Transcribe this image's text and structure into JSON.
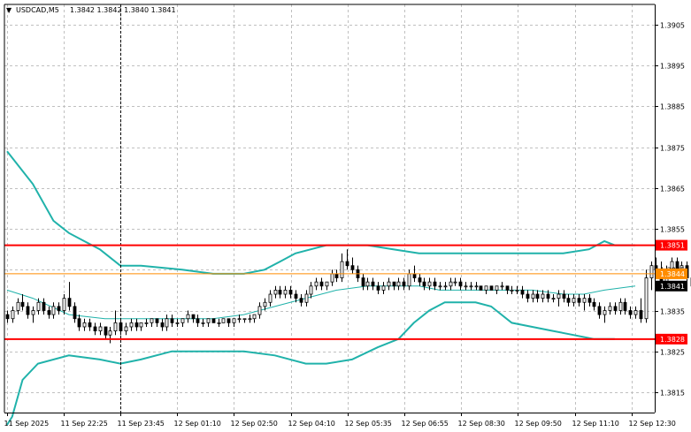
{
  "window": {
    "menu_glyph": "▼",
    "symbol_timeframe": "USDCAD,M5",
    "ohlc": "1.3842 1.3842 1.3840 1.3841"
  },
  "colors": {
    "bull": "#ffffff",
    "bear": "#000000",
    "candle_outline": "#000000",
    "band": "#20b2aa",
    "support_resistance": "#ff0000",
    "bid_line": "#ff8c00",
    "grid": "#c0c0c0",
    "axis": "#000000"
  },
  "chart_data": {
    "type": "candlestick",
    "symbol": "USDCAD",
    "timeframe": "M5",
    "ylim": [
      1.381,
      1.391
    ],
    "grid": true,
    "x_tick_labels": [
      "11 Sep 2025",
      "11 Sep 22:25",
      "11 Sep 23:45",
      "12 Sep 01:10",
      "12 Sep 02:50",
      "12 Sep 04:10",
      "12 Sep 05:35",
      "12 Sep 06:55",
      "12 Sep 08:30",
      "12 Sep 09:50",
      "12 Sep 11:10",
      "12 Sep 12:30"
    ],
    "y_ticks": [
      {
        "value": 1.3905,
        "label": "1.3905"
      },
      {
        "value": 1.3895,
        "label": "1.3895"
      },
      {
        "value": 1.3885,
        "label": "1.3885"
      },
      {
        "value": 1.3875,
        "label": "1.3875"
      },
      {
        "value": 1.3865,
        "label": "1.3865"
      },
      {
        "value": 1.3855,
        "label": "1.3855"
      },
      {
        "value": 1.3845,
        "label": "1.3845"
      },
      {
        "value": 1.3835,
        "label": "1.3835"
      },
      {
        "value": 1.3825,
        "label": "1.3825"
      },
      {
        "value": 1.3815,
        "label": "1.3815"
      }
    ],
    "horizontal_lines": [
      {
        "name": "resistance",
        "value": 1.3851,
        "label": "1.3851"
      },
      {
        "name": "support",
        "value": 1.3828,
        "label": "1.3828"
      }
    ],
    "bid_line": {
      "value": 1.3844,
      "label": "1.3844"
    },
    "current_price": {
      "value": 1.3841,
      "label": "1.3841"
    },
    "vertical_marker_index": 22,
    "candles": [
      [
        1.3834,
        1.3835,
        1.3832,
        1.3833
      ],
      [
        1.3833,
        1.3836,
        1.3832,
        1.3835
      ],
      [
        1.3835,
        1.3838,
        1.3834,
        1.3837
      ],
      [
        1.3837,
        1.3839,
        1.3835,
        1.3836
      ],
      [
        1.3836,
        1.3837,
        1.3833,
        1.3834
      ],
      [
        1.3834,
        1.3836,
        1.3832,
        1.3835
      ],
      [
        1.3835,
        1.3838,
        1.3834,
        1.3837
      ],
      [
        1.3837,
        1.3838,
        1.3834,
        1.3835
      ],
      [
        1.3835,
        1.3836,
        1.3833,
        1.3834
      ],
      [
        1.3834,
        1.3837,
        1.3833,
        1.3836
      ],
      [
        1.3836,
        1.3837,
        1.3834,
        1.3835
      ],
      [
        1.3835,
        1.3839,
        1.3834,
        1.3838
      ],
      [
        1.3838,
        1.3842,
        1.3835,
        1.3836
      ],
      [
        1.3836,
        1.3837,
        1.3832,
        1.3833
      ],
      [
        1.3833,
        1.3834,
        1.383,
        1.3831
      ],
      [
        1.3831,
        1.3833,
        1.383,
        1.3832
      ],
      [
        1.3832,
        1.3833,
        1.383,
        1.3831
      ],
      [
        1.3831,
        1.3832,
        1.3829,
        1.383
      ],
      [
        1.383,
        1.3832,
        1.3829,
        1.3831
      ],
      [
        1.3831,
        1.3831,
        1.3828,
        1.3829
      ],
      [
        1.3829,
        1.3831,
        1.3827,
        1.383
      ],
      [
        1.383,
        1.3835,
        1.3829,
        1.3832
      ],
      [
        1.3832,
        1.3833,
        1.3829,
        1.383
      ],
      [
        1.383,
        1.3832,
        1.3829,
        1.3831
      ],
      [
        1.3831,
        1.3833,
        1.383,
        1.3832
      ],
      [
        1.3832,
        1.3833,
        1.383,
        1.3831
      ],
      [
        1.3831,
        1.3832,
        1.383,
        1.3832
      ],
      [
        1.3832,
        1.3833,
        1.3831,
        1.3832
      ],
      [
        1.3832,
        1.3833,
        1.3831,
        1.3833
      ],
      [
        1.3833,
        1.3833,
        1.3831,
        1.3832
      ],
      [
        1.3832,
        1.3833,
        1.383,
        1.3831
      ],
      [
        1.3831,
        1.3834,
        1.383,
        1.3833
      ],
      [
        1.3833,
        1.3834,
        1.3831,
        1.3832
      ],
      [
        1.3832,
        1.3833,
        1.3831,
        1.3832
      ],
      [
        1.3832,
        1.3833,
        1.3831,
        1.3833
      ],
      [
        1.3833,
        1.3835,
        1.3832,
        1.3834
      ],
      [
        1.3834,
        1.3834,
        1.3832,
        1.3833
      ],
      [
        1.3833,
        1.3834,
        1.3831,
        1.3832
      ],
      [
        1.3832,
        1.3833,
        1.3831,
        1.3832
      ],
      [
        1.3832,
        1.3833,
        1.3831,
        1.3833
      ],
      [
        1.3833,
        1.3833,
        1.3832,
        1.3832
      ],
      [
        1.3832,
        1.3833,
        1.3831,
        1.3832
      ],
      [
        1.3832,
        1.3833,
        1.3832,
        1.3833
      ],
      [
        1.3833,
        1.3833,
        1.3831,
        1.3832
      ],
      [
        1.3832,
        1.3833,
        1.3831,
        1.3833
      ],
      [
        1.3833,
        1.3834,
        1.3832,
        1.3833
      ],
      [
        1.3833,
        1.3833,
        1.3832,
        1.3833
      ],
      [
        1.3833,
        1.3834,
        1.3832,
        1.3833
      ],
      [
        1.3833,
        1.3834,
        1.3832,
        1.3834
      ],
      [
        1.3834,
        1.3837,
        1.3833,
        1.3836
      ],
      [
        1.3836,
        1.3838,
        1.3835,
        1.3837
      ],
      [
        1.3837,
        1.384,
        1.3836,
        1.3839
      ],
      [
        1.3839,
        1.3841,
        1.3838,
        1.384
      ],
      [
        1.384,
        1.3841,
        1.3838,
        1.3839
      ],
      [
        1.3839,
        1.3841,
        1.3838,
        1.384
      ],
      [
        1.384,
        1.3841,
        1.3838,
        1.3839
      ],
      [
        1.3839,
        1.384,
        1.3837,
        1.3838
      ],
      [
        1.3838,
        1.3839,
        1.3836,
        1.3837
      ],
      [
        1.3837,
        1.384,
        1.3836,
        1.3839
      ],
      [
        1.3839,
        1.3842,
        1.3838,
        1.3841
      ],
      [
        1.3841,
        1.3843,
        1.384,
        1.3842
      ],
      [
        1.3842,
        1.3843,
        1.384,
        1.3841
      ],
      [
        1.3841,
        1.3842,
        1.384,
        1.3842
      ],
      [
        1.3842,
        1.3845,
        1.3841,
        1.3844
      ],
      [
        1.3844,
        1.3845,
        1.3842,
        1.3843
      ],
      [
        1.3843,
        1.3849,
        1.3842,
        1.3847
      ],
      [
        1.3847,
        1.385,
        1.3845,
        1.3846
      ],
      [
        1.3846,
        1.3848,
        1.3844,
        1.3845
      ],
      [
        1.3845,
        1.3846,
        1.3842,
        1.3843
      ],
      [
        1.3843,
        1.3844,
        1.384,
        1.3841
      ],
      [
        1.3841,
        1.3843,
        1.384,
        1.3842
      ],
      [
        1.3842,
        1.3843,
        1.384,
        1.3841
      ],
      [
        1.3841,
        1.3842,
        1.3839,
        1.384
      ],
      [
        1.384,
        1.3842,
        1.3839,
        1.3841
      ],
      [
        1.3841,
        1.3843,
        1.384,
        1.3842
      ],
      [
        1.3842,
        1.3842,
        1.384,
        1.3841
      ],
      [
        1.3841,
        1.3843,
        1.384,
        1.3842
      ],
      [
        1.3842,
        1.3843,
        1.384,
        1.3841
      ],
      [
        1.3841,
        1.3845,
        1.384,
        1.3844
      ],
      [
        1.3844,
        1.3846,
        1.3842,
        1.3843
      ],
      [
        1.3843,
        1.3844,
        1.3841,
        1.3842
      ],
      [
        1.3842,
        1.3843,
        1.384,
        1.3841
      ],
      [
        1.3841,
        1.3843,
        1.384,
        1.3842
      ],
      [
        1.3842,
        1.3843,
        1.384,
        1.3841
      ],
      [
        1.3841,
        1.3842,
        1.384,
        1.3841
      ],
      [
        1.3841,
        1.3842,
        1.384,
        1.3841
      ],
      [
        1.3841,
        1.3843,
        1.384,
        1.3842
      ],
      [
        1.3842,
        1.3843,
        1.3841,
        1.3842
      ],
      [
        1.3842,
        1.3843,
        1.384,
        1.3841
      ],
      [
        1.3841,
        1.3842,
        1.384,
        1.3841
      ],
      [
        1.3841,
        1.3842,
        1.384,
        1.3841
      ],
      [
        1.3841,
        1.3842,
        1.384,
        1.3841
      ],
      [
        1.3841,
        1.3841,
        1.384,
        1.384
      ],
      [
        1.384,
        1.3841,
        1.3839,
        1.3841
      ],
      [
        1.3841,
        1.3841,
        1.384,
        1.384
      ],
      [
        1.384,
        1.3841,
        1.3839,
        1.3841
      ],
      [
        1.3841,
        1.3842,
        1.384,
        1.3841
      ],
      [
        1.3841,
        1.3841,
        1.3839,
        1.384
      ],
      [
        1.384,
        1.3841,
        1.3839,
        1.384
      ],
      [
        1.384,
        1.3841,
        1.3839,
        1.384
      ],
      [
        1.384,
        1.3841,
        1.3838,
        1.3839
      ],
      [
        1.3839,
        1.384,
        1.3837,
        1.3838
      ],
      [
        1.3838,
        1.384,
        1.3837,
        1.3839
      ],
      [
        1.3839,
        1.384,
        1.3837,
        1.3838
      ],
      [
        1.3838,
        1.384,
        1.3837,
        1.3839
      ],
      [
        1.3839,
        1.384,
        1.3837,
        1.3838
      ],
      [
        1.3838,
        1.3839,
        1.3837,
        1.3838
      ],
      [
        1.3838,
        1.384,
        1.3836,
        1.3839
      ],
      [
        1.3839,
        1.384,
        1.3837,
        1.3838
      ],
      [
        1.3838,
        1.3839,
        1.3836,
        1.3837
      ],
      [
        1.3837,
        1.3839,
        1.3836,
        1.3838
      ],
      [
        1.3838,
        1.3839,
        1.3836,
        1.3837
      ],
      [
        1.3837,
        1.3839,
        1.3835,
        1.3838
      ],
      [
        1.3838,
        1.3839,
        1.3836,
        1.3837
      ],
      [
        1.3837,
        1.3838,
        1.3835,
        1.3836
      ],
      [
        1.3836,
        1.3837,
        1.3833,
        1.3834
      ],
      [
        1.3834,
        1.3836,
        1.3832,
        1.3835
      ],
      [
        1.3835,
        1.3837,
        1.3834,
        1.3836
      ],
      [
        1.3836,
        1.3837,
        1.3834,
        1.3835
      ],
      [
        1.3835,
        1.3838,
        1.3834,
        1.3837
      ],
      [
        1.3837,
        1.3838,
        1.3834,
        1.3835
      ],
      [
        1.3835,
        1.3836,
        1.3833,
        1.3834
      ],
      [
        1.3834,
        1.3836,
        1.3833,
        1.3835
      ],
      [
        1.3835,
        1.3838,
        1.3832,
        1.3833
      ],
      [
        1.3833,
        1.3845,
        1.3832,
        1.3843
      ],
      [
        1.3843,
        1.3847,
        1.384,
        1.3846
      ],
      [
        1.3846,
        1.3848,
        1.3844,
        1.3845
      ],
      [
        1.3845,
        1.3847,
        1.3841,
        1.3842
      ],
      [
        1.3842,
        1.3846,
        1.3841,
        1.3845
      ],
      [
        1.3845,
        1.3848,
        1.3844,
        1.3847
      ],
      [
        1.3847,
        1.3848,
        1.3844,
        1.3845
      ],
      [
        1.3845,
        1.3847,
        1.3844,
        1.3846
      ],
      [
        1.3846,
        1.3847,
        1.3842,
        1.3843
      ],
      [
        1.3843,
        1.3844,
        1.384,
        1.3841
      ],
      [
        1.3841,
        1.3843,
        1.384,
        1.3842
      ],
      [
        1.3842,
        1.3843,
        1.384,
        1.3841
      ],
      [
        1.3841,
        1.3842,
        1.384,
        1.3841
      ]
    ],
    "bands": {
      "upper": [
        [
          0,
          1.3874
        ],
        [
          5,
          1.3866
        ],
        [
          9,
          1.3857
        ],
        [
          12,
          1.3854
        ],
        [
          15,
          1.3852
        ],
        [
          18,
          1.385
        ],
        [
          22,
          1.3846
        ],
        [
          26,
          1.3846
        ],
        [
          34,
          1.3845
        ],
        [
          40,
          1.3844
        ],
        [
          46,
          1.3844
        ],
        [
          50,
          1.3845
        ],
        [
          53,
          1.3847
        ],
        [
          56,
          1.3849
        ],
        [
          59,
          1.385
        ],
        [
          62,
          1.3851
        ],
        [
          66,
          1.3851
        ],
        [
          70,
          1.3851
        ],
        [
          75,
          1.385
        ],
        [
          80,
          1.3849
        ],
        [
          87,
          1.3849
        ],
        [
          92,
          1.3849
        ],
        [
          98,
          1.3849
        ],
        [
          104,
          1.3849
        ],
        [
          108,
          1.3849
        ],
        [
          113,
          1.385
        ],
        [
          116,
          1.3852
        ],
        [
          118,
          1.3851
        ],
        [
          122,
          1.3851
        ]
      ],
      "middle": [
        [
          0,
          1.384
        ],
        [
          5,
          1.3838
        ],
        [
          12,
          1.3834
        ],
        [
          19,
          1.3833
        ],
        [
          26,
          1.3833
        ],
        [
          33,
          1.3833
        ],
        [
          40,
          1.3833
        ],
        [
          46,
          1.3834
        ],
        [
          52,
          1.3836
        ],
        [
          58,
          1.3838
        ],
        [
          64,
          1.384
        ],
        [
          70,
          1.3841
        ],
        [
          76,
          1.3841
        ],
        [
          80,
          1.3841
        ],
        [
          84,
          1.384
        ],
        [
          90,
          1.384
        ],
        [
          96,
          1.384
        ],
        [
          102,
          1.384
        ],
        [
          108,
          1.3839
        ],
        [
          112,
          1.3839
        ],
        [
          116,
          1.384
        ],
        [
          122,
          1.3841
        ]
      ],
      "lower": [
        [
          0,
          1.3807
        ],
        [
          1,
          1.3809
        ],
        [
          3,
          1.3818
        ],
        [
          6,
          1.3822
        ],
        [
          12,
          1.3824
        ],
        [
          18,
          1.3823
        ],
        [
          22,
          1.3822
        ],
        [
          26,
          1.3823
        ],
        [
          32,
          1.3825
        ],
        [
          40,
          1.3825
        ],
        [
          46,
          1.3825
        ],
        [
          52,
          1.3824
        ],
        [
          58,
          1.3822
        ],
        [
          62,
          1.3822
        ],
        [
          67,
          1.3823
        ],
        [
          72,
          1.3826
        ],
        [
          76,
          1.3828
        ],
        [
          79,
          1.3832
        ],
        [
          82,
          1.3835
        ],
        [
          85,
          1.3837
        ],
        [
          91,
          1.3837
        ],
        [
          94,
          1.3836
        ],
        [
          98,
          1.3832
        ],
        [
          102,
          1.3831
        ],
        [
          106,
          1.383
        ],
        [
          110,
          1.3829
        ],
        [
          114,
          1.3828
        ],
        [
          118,
          1.3828
        ]
      ]
    }
  }
}
